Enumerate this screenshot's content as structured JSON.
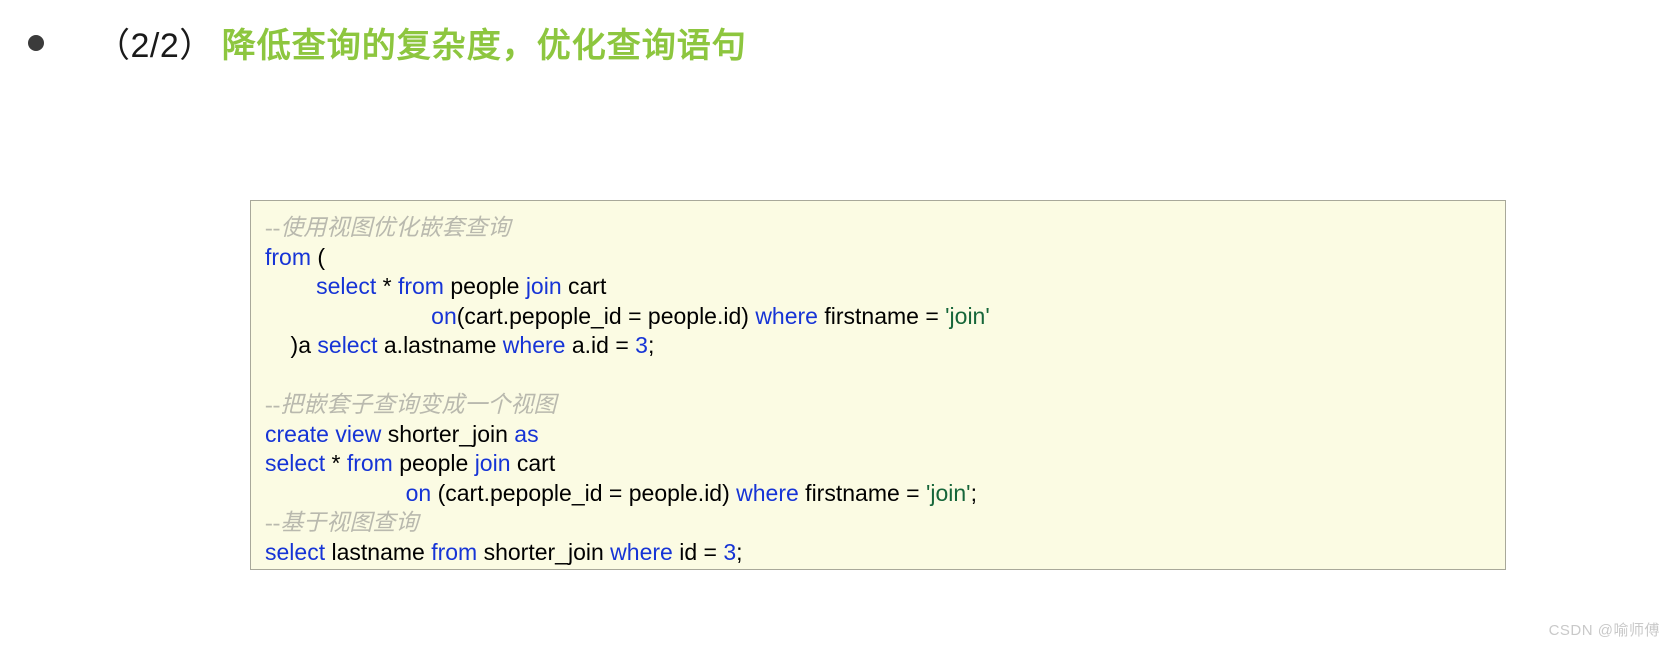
{
  "heading": {
    "bullet": "bullet-marker",
    "index": "（2/2）",
    "title": "降低查询的复杂度，优化查询语句",
    "title_color": "#8dc63f"
  },
  "code_block": {
    "background": "#fbfbe3",
    "border_color": "#a8a89a",
    "keyword_color": "#1634d6",
    "string_color": "#16663a",
    "comment_color": "#b9b9ae",
    "text_color": "#000000",
    "lines": [
      {
        "id": "line-1",
        "indent": 0,
        "tokens": [
          {
            "type": "comment",
            "text": "--使用视图优化嵌套查询"
          }
        ]
      },
      {
        "id": "line-2",
        "indent": 0,
        "tokens": [
          {
            "type": "keyword",
            "text": "from"
          },
          {
            "type": "plain",
            "text": " ("
          }
        ]
      },
      {
        "id": "line-3",
        "indent": 0,
        "tokens": [
          {
            "type": "plain",
            "text": "        "
          },
          {
            "type": "keyword",
            "text": "select"
          },
          {
            "type": "plain",
            "text": " * "
          },
          {
            "type": "keyword",
            "text": "from"
          },
          {
            "type": "plain",
            "text": " people "
          },
          {
            "type": "keyword",
            "text": "join"
          },
          {
            "type": "plain",
            "text": " cart"
          }
        ]
      },
      {
        "id": "line-4",
        "indent": 0,
        "tokens": [
          {
            "type": "plain",
            "text": "                          "
          },
          {
            "type": "keyword",
            "text": "on"
          },
          {
            "type": "plain",
            "text": "(cart.pepople_id = people.id) "
          },
          {
            "type": "keyword",
            "text": "where"
          },
          {
            "type": "plain",
            "text": " firstname = "
          },
          {
            "type": "string",
            "text": "'join'"
          }
        ]
      },
      {
        "id": "line-5",
        "indent": 0,
        "tokens": [
          {
            "type": "plain",
            "text": "    )a "
          },
          {
            "type": "keyword",
            "text": "select"
          },
          {
            "type": "plain",
            "text": " a.lastname "
          },
          {
            "type": "keyword",
            "text": "where"
          },
          {
            "type": "plain",
            "text": " a.id = "
          },
          {
            "type": "number",
            "text": "3"
          },
          {
            "type": "plain",
            "text": ";"
          }
        ]
      },
      {
        "id": "line-6",
        "indent": 0,
        "tokens": []
      },
      {
        "id": "line-7",
        "indent": 0,
        "tokens": [
          {
            "type": "comment",
            "text": "--把嵌套子查询变成一个视图"
          }
        ]
      },
      {
        "id": "line-8",
        "indent": 0,
        "tokens": [
          {
            "type": "keyword",
            "text": "create view"
          },
          {
            "type": "plain",
            "text": " shorter_join "
          },
          {
            "type": "keyword",
            "text": "as"
          }
        ]
      },
      {
        "id": "line-9",
        "indent": 0,
        "tokens": [
          {
            "type": "keyword",
            "text": "select"
          },
          {
            "type": "plain",
            "text": " * "
          },
          {
            "type": "keyword",
            "text": "from"
          },
          {
            "type": "plain",
            "text": " people "
          },
          {
            "type": "keyword",
            "text": "join"
          },
          {
            "type": "plain",
            "text": " cart"
          }
        ]
      },
      {
        "id": "line-10",
        "indent": 0,
        "tokens": [
          {
            "type": "plain",
            "text": "                      "
          },
          {
            "type": "keyword",
            "text": "on"
          },
          {
            "type": "plain",
            "text": " (cart.pepople_id = people.id) "
          },
          {
            "type": "keyword",
            "text": "where"
          },
          {
            "type": "plain",
            "text": " firstname = "
          },
          {
            "type": "string",
            "text": "'join'"
          },
          {
            "type": "plain",
            "text": ";"
          }
        ]
      },
      {
        "id": "line-11",
        "indent": 0,
        "tokens": [
          {
            "type": "comment",
            "text": "--基于视图查询"
          }
        ]
      },
      {
        "id": "line-12",
        "indent": 0,
        "tokens": [
          {
            "type": "keyword",
            "text": "select"
          },
          {
            "type": "plain",
            "text": " lastname "
          },
          {
            "type": "keyword",
            "text": "from"
          },
          {
            "type": "plain",
            "text": " shorter_join "
          },
          {
            "type": "keyword",
            "text": "where"
          },
          {
            "type": "plain",
            "text": " id = "
          },
          {
            "type": "number",
            "text": "3"
          },
          {
            "type": "plain",
            "text": ";"
          }
        ]
      }
    ]
  },
  "watermark": {
    "text": "CSDN @喻师傅"
  }
}
